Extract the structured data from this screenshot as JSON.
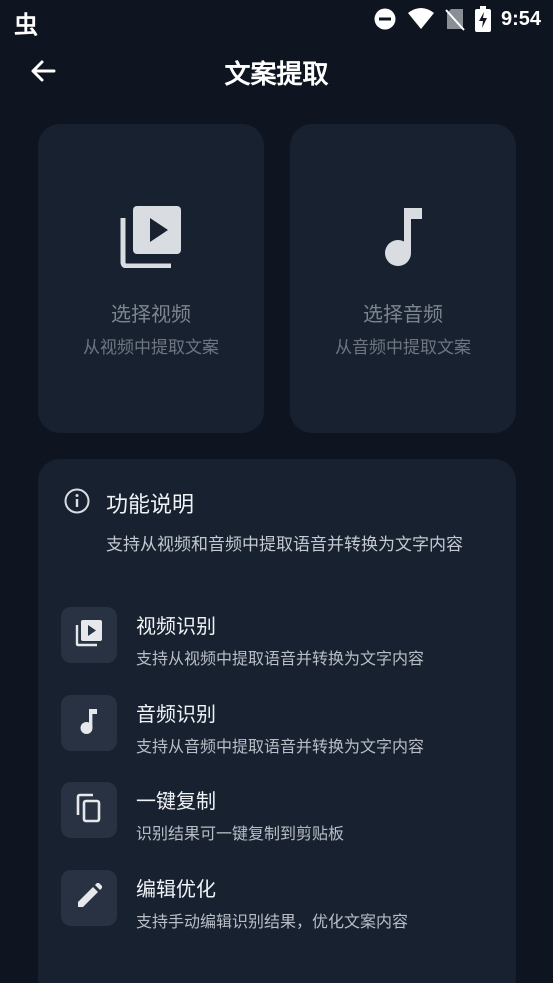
{
  "status_bar": {
    "app_glyph": "虫",
    "time": "9:54",
    "icons": [
      "do-not-disturb-icon",
      "wifi-icon",
      "no-sim-icon",
      "battery-charging-icon"
    ]
  },
  "header": {
    "title": "文案提取",
    "back_icon": "arrow-left-icon"
  },
  "pickers": [
    {
      "icon": "video-library-icon",
      "title": "选择视频",
      "subtitle": "从视频中提取文案"
    },
    {
      "icon": "music-note-icon",
      "title": "选择音频",
      "subtitle": "从音频中提取文案"
    }
  ],
  "feature_panel": {
    "icon": "info-icon",
    "title": "功能说明",
    "description": "支持从视频和音频中提取语音并转换为文字内容",
    "items": [
      {
        "icon": "video-library-icon",
        "title": "视频识别",
        "desc": "支持从视频中提取语音并转换为文字内容"
      },
      {
        "icon": "music-note-icon",
        "title": "音频识别",
        "desc": "支持从音频中提取语音并转换为文字内容"
      },
      {
        "icon": "copy-icon",
        "title": "一键复制",
        "desc": "识别结果可一键复制到剪贴板"
      },
      {
        "icon": "edit-pencil-icon",
        "title": "编辑优化",
        "desc": "支持手动编辑识别结果，优化文案内容"
      }
    ]
  },
  "colors": {
    "background": "#0f1520",
    "card": "#172130",
    "icon_box": "#283242",
    "muted_text": "#7d848e",
    "icon_light": "#e6e8ec"
  }
}
